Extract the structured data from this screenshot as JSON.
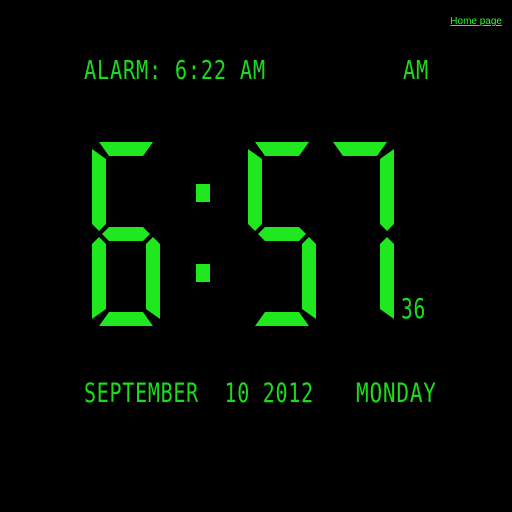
{
  "nav": {
    "home_label": "Home page"
  },
  "alarm": {
    "label": "ALARM:",
    "time": "6:22 AM",
    "display": "ALARM: 6:22 AM"
  },
  "clock": {
    "hour": "6",
    "minutes": "57",
    "separator": ":",
    "seconds": "36",
    "meridiem": "AM"
  },
  "date": {
    "month": "SEPTEMBER",
    "day": "10",
    "year": "2012",
    "display": "SEPTEMBER  10 2012",
    "weekday": "MONDAY"
  },
  "theme": {
    "background": "#000000",
    "digit_color": "#1fe81f",
    "link_color": "#22ff22"
  },
  "icons": {
    "colon": "colon-dots"
  }
}
